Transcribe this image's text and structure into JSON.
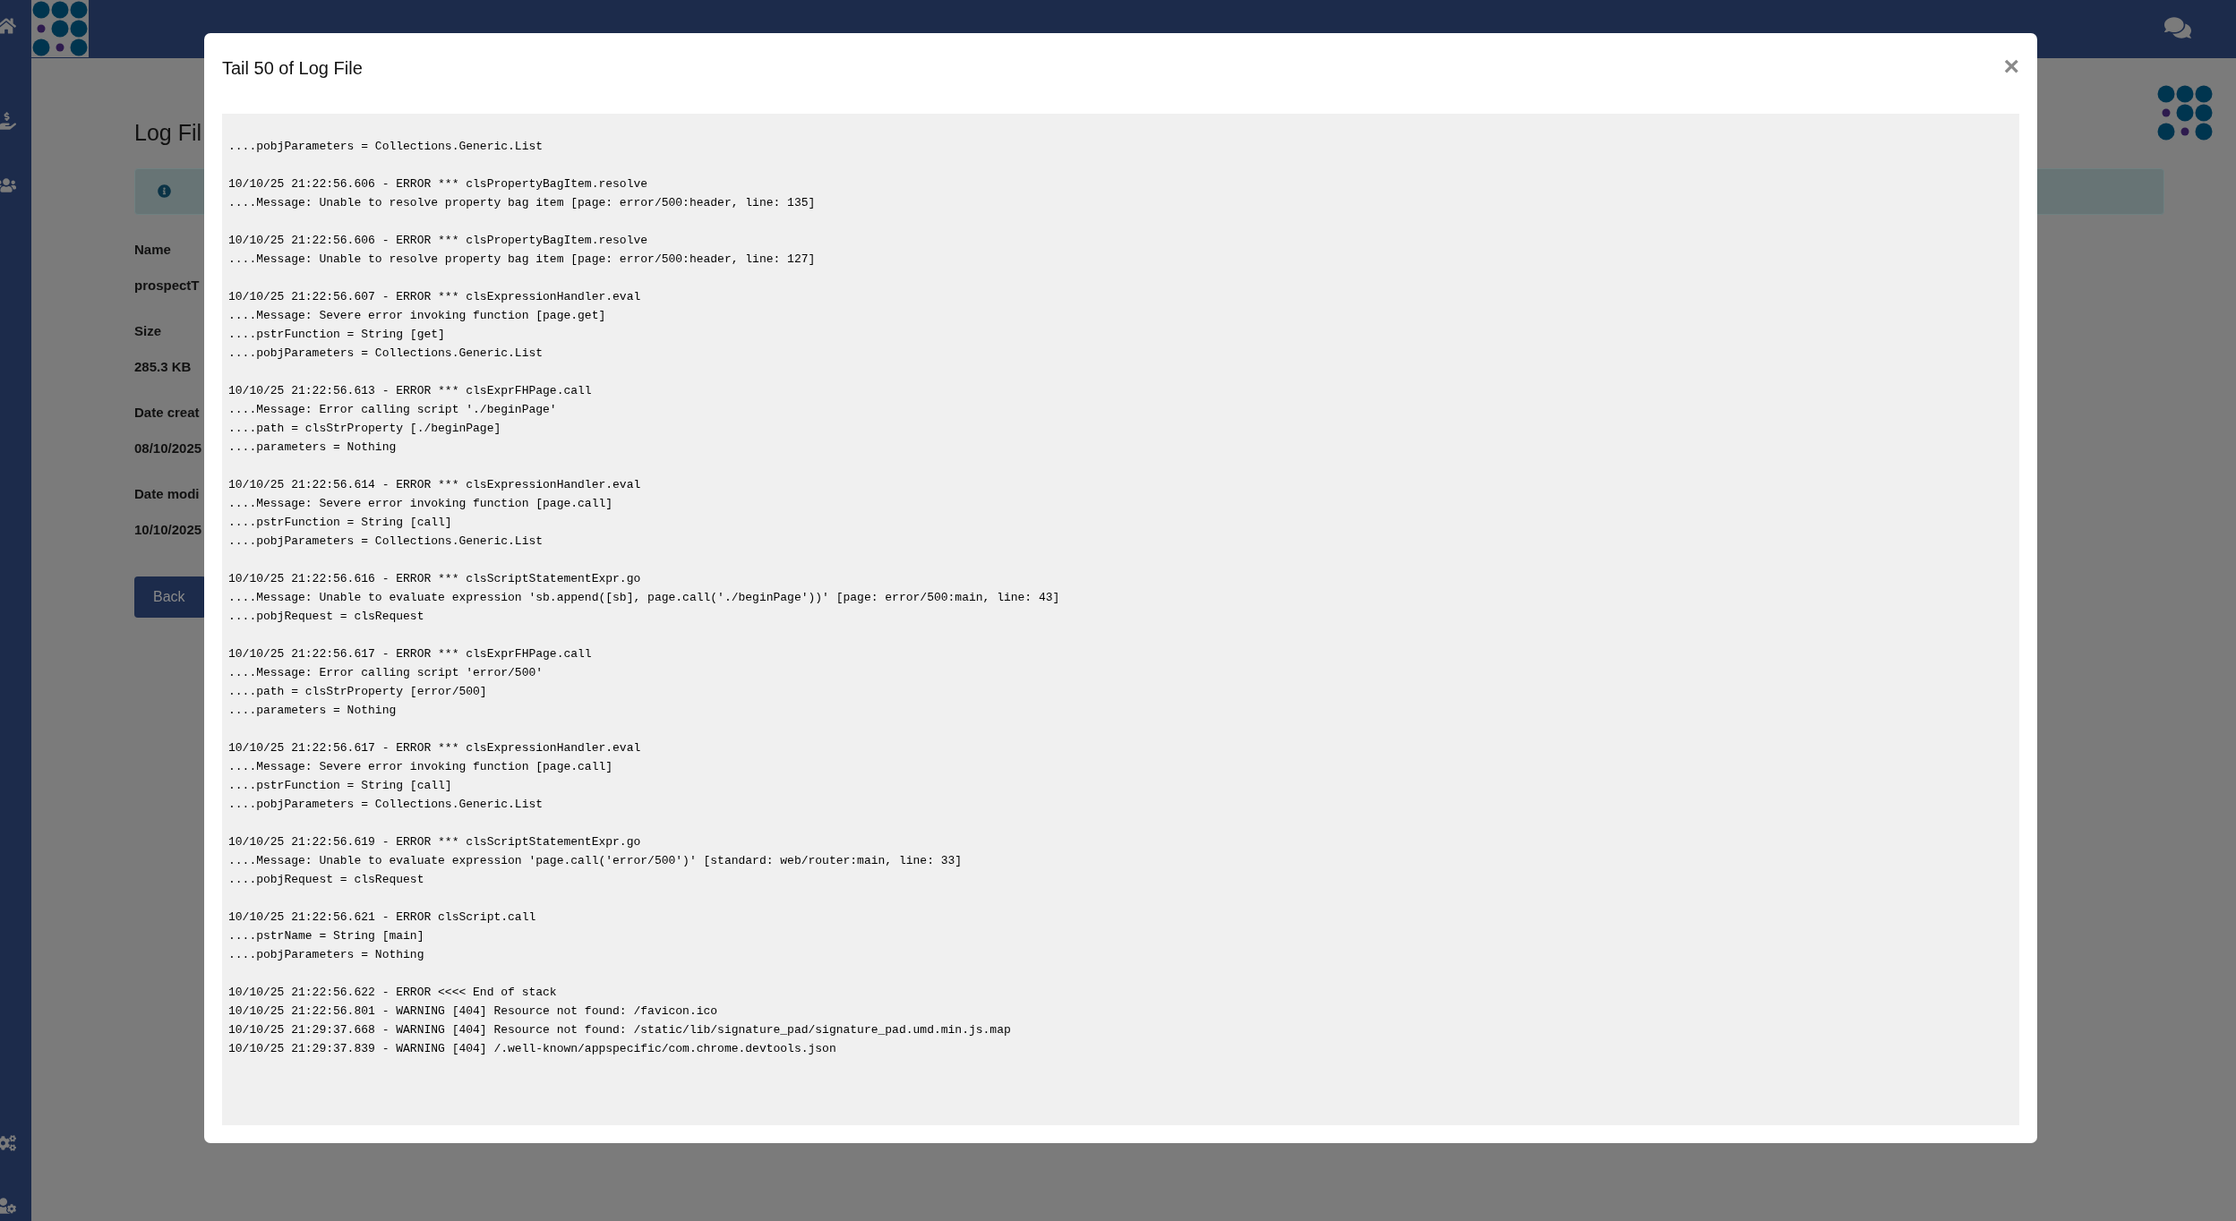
{
  "page": {
    "title": "Log Fil",
    "fields": [
      {
        "label": "Name",
        "value": "prospectT"
      },
      {
        "label": "Size",
        "value": "285.3 KB"
      },
      {
        "label": "Date creat",
        "value": "08/10/2025"
      },
      {
        "label": "Date modi",
        "value": "10/10/2025"
      }
    ],
    "back_button": "Back"
  },
  "modal": {
    "title": "Tail 50 of Log File",
    "close": "×",
    "log_blocks": [
      [
        "....pobjParameters = Collections.Generic.List"
      ],
      [
        "10/10/25 21:22:56.606 - ERROR *** clsPropertyBagItem.resolve",
        "....Message: Unable to resolve property bag item [page: error/500:header, line: 135]"
      ],
      [
        "10/10/25 21:22:56.606 - ERROR *** clsPropertyBagItem.resolve",
        "....Message: Unable to resolve property bag item [page: error/500:header, line: 127]"
      ],
      [
        "10/10/25 21:22:56.607 - ERROR *** clsExpressionHandler.eval",
        "....Message: Severe error invoking function [page.get]",
        "....pstrFunction = String [get]",
        "....pobjParameters = Collections.Generic.List"
      ],
      [
        "10/10/25 21:22:56.613 - ERROR *** clsExprFHPage.call",
        "....Message: Error calling script './beginPage'",
        "....path = clsStrProperty [./beginPage]",
        "....parameters = Nothing"
      ],
      [
        "10/10/25 21:22:56.614 - ERROR *** clsExpressionHandler.eval",
        "....Message: Severe error invoking function [page.call]",
        "....pstrFunction = String [call]",
        "....pobjParameters = Collections.Generic.List"
      ],
      [
        "10/10/25 21:22:56.616 - ERROR *** clsScriptStatementExpr.go",
        "....Message: Unable to evaluate expression 'sb.append([sb], page.call('./beginPage'))' [page: error/500:main, line: 43]",
        "....pobjRequest = clsRequest"
      ],
      [
        "10/10/25 21:22:56.617 - ERROR *** clsExprFHPage.call",
        "....Message: Error calling script 'error/500'",
        "....path = clsStrProperty [error/500]",
        "....parameters = Nothing"
      ],
      [
        "10/10/25 21:22:56.617 - ERROR *** clsExpressionHandler.eval",
        "....Message: Severe error invoking function [page.call]",
        "....pstrFunction = String [call]",
        "....pobjParameters = Collections.Generic.List"
      ],
      [
        "10/10/25 21:22:56.619 - ERROR *** clsScriptStatementExpr.go",
        "....Message: Unable to evaluate expression 'page.call('error/500')' [standard: web/router:main, line: 33]",
        "....pobjRequest = clsRequest"
      ],
      [
        "10/10/25 21:22:56.621 - ERROR clsScript.call",
        "....pstrName = String [main]",
        "....pobjParameters = Nothing"
      ],
      [
        "10/10/25 21:22:56.622 - ERROR <<<< End of stack",
        "10/10/25 21:22:56.801 - WARNING [404] Resource not found: /favicon.ico",
        "10/10/25 21:29:37.668 - WARNING [404] Resource not found: /static/lib/signature_pad/signature_pad.umd.min.js.map",
        "10/10/25 21:29:37.839 - WARNING [404] /.well-known/appspecific/com.chrome.devtools.json"
      ]
    ]
  }
}
